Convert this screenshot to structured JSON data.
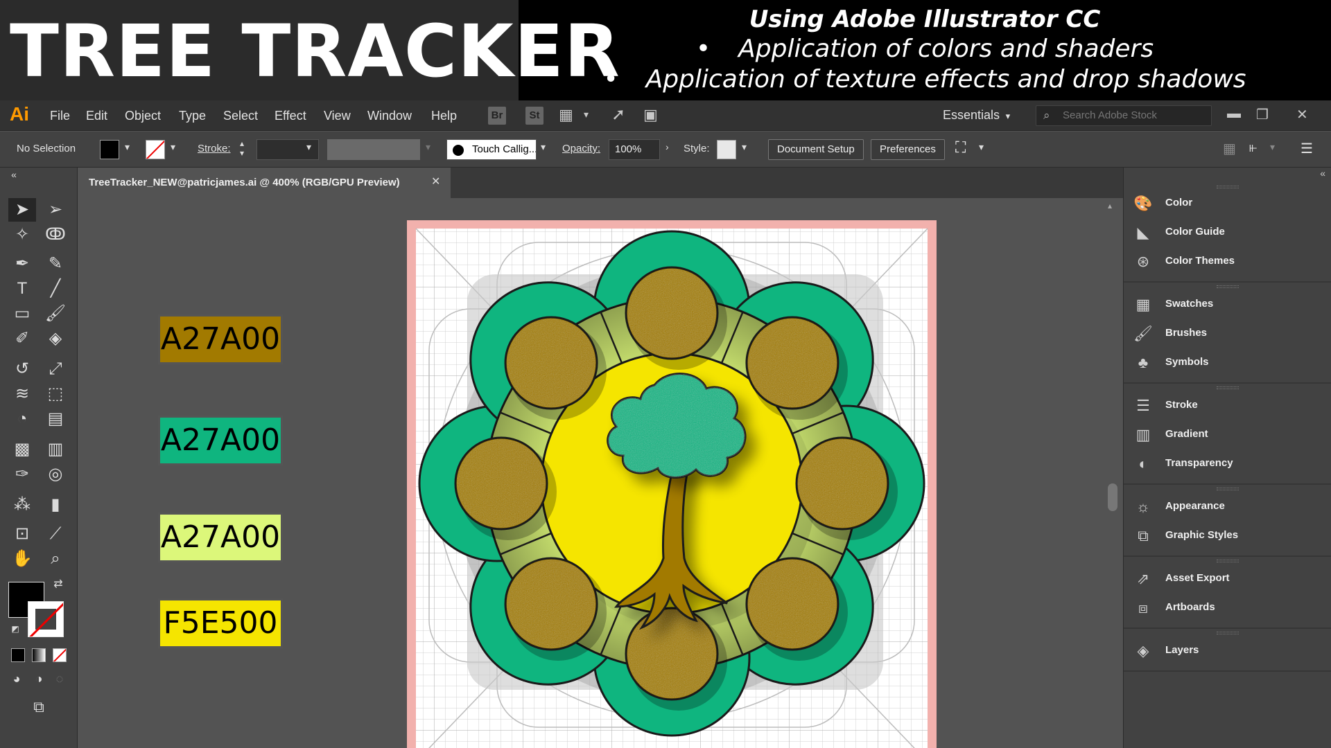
{
  "banner": {
    "title": "TREE TRACKER",
    "heading": "Using Adobe Illustrator CC",
    "bullets": [
      "Application of colors and shaders",
      "Application of texture effects and drop shadows"
    ]
  },
  "menubar": {
    "logo": "Ai",
    "items": [
      "File",
      "Edit",
      "Object",
      "Type",
      "Select",
      "Effect",
      "View",
      "Window",
      "Help"
    ],
    "bridge": "Br",
    "stock": "St",
    "workspace": "Essentials",
    "search_placeholder": "Search Adobe Stock"
  },
  "controlbar": {
    "selection": "No Selection",
    "stroke_label": "Stroke:",
    "brush": "Touch Callig...",
    "opacity_label": "Opacity:",
    "opacity_value": "100%",
    "style_label": "Style:",
    "document_setup": "Document Setup",
    "preferences": "Preferences"
  },
  "document": {
    "tab_title": "TreeTracker_NEW@patricjames.ai @ 400% (RGB/GPU Preview)"
  },
  "color_labels": [
    {
      "text": "A27A00",
      "fill": "#A27A00"
    },
    {
      "text": "A27A00",
      "fill": "#0FB57F"
    },
    {
      "text": "A27A00",
      "fill": "#DCF77A"
    },
    {
      "text": "F5E500",
      "fill": "#F5E500"
    }
  ],
  "right_panel": {
    "groups": [
      [
        "Color",
        "Color Guide",
        "Color Themes"
      ],
      [
        "Swatches",
        "Brushes",
        "Symbols"
      ],
      [
        "Stroke",
        "Gradient",
        "Transparency"
      ],
      [
        "Appearance",
        "Graphic Styles"
      ],
      [
        "Asset Export",
        "Artboards"
      ],
      [
        "Layers"
      ]
    ]
  },
  "colors": {
    "green": "#0FB57F",
    "brown": "#A27A00",
    "light_green": "#DCF77A",
    "yellow": "#F5E500"
  }
}
